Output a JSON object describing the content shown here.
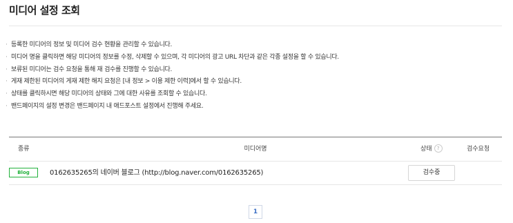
{
  "page": {
    "title": "미디어 설정 조회"
  },
  "notes": [
    "등록한 미디어의 정보 및 미디어 검수 현황을 관리할 수 있습니다.",
    "미디어 명을 클릭하면 해당 미디어의 정보를 수정, 삭제할 수 있으며, 각 미디어의 광고 URL 차단과 같은 각종 설정을 할 수 있습니다.",
    "보류된 미디어는 검수 요청을 통해 재 검수를 진행할 수 있습니다.",
    "게재 제한된 미디어의 게재 제한 해지 요청은 [내 정보 > 이용 제한 이력]에서 할 수 있습니다.",
    "상태를 클릭하시면 해당 미디어의 상태와 그에 대한 사유를 조회할 수 있습니다.",
    "밴드페이지의 설정 변경은 밴드페이지 내 애드포스트 설정에서 진행해 주세요."
  ],
  "table": {
    "headers": {
      "type": "종류",
      "media": "미디어명",
      "status": "상태",
      "review": "검수요청"
    },
    "help_icon_glyph": "?",
    "rows": [
      {
        "type_badge": "Blog",
        "media_name": "0162635265의 네이버 블로그 (http://blog.naver.com/0162635265)",
        "status": "검수중",
        "review": ""
      }
    ]
  },
  "pagination": {
    "current_page": "1"
  },
  "colors": {
    "badge_green": "#20b13a",
    "page_link_blue": "#3b6fc5"
  }
}
